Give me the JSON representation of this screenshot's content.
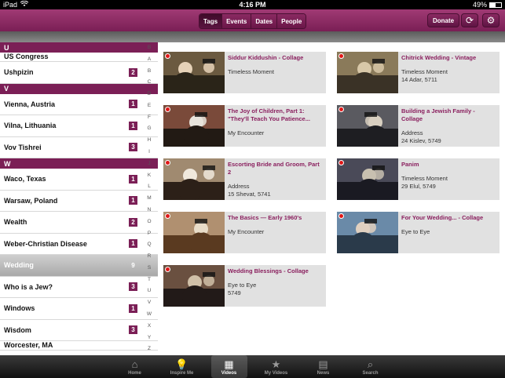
{
  "status_bar": {
    "device": "iPad",
    "time": "4:16 PM",
    "battery_percent_text": "49%",
    "battery_level": 0.49
  },
  "nav": {
    "segments": [
      {
        "label": "Tags",
        "active": true
      },
      {
        "label": "Events",
        "active": false
      },
      {
        "label": "Dates",
        "active": false
      },
      {
        "label": "People",
        "active": false
      }
    ],
    "donate_label": "Donate",
    "refresh_icon": "refresh-icon",
    "settings_icon": "gear-icon"
  },
  "tag_list": {
    "rows": [
      {
        "type": "header",
        "text": "U"
      },
      {
        "type": "partial",
        "text": "US Congress"
      },
      {
        "type": "row",
        "text": "Ushpizin",
        "count": "2"
      },
      {
        "type": "header",
        "text": "V"
      },
      {
        "type": "row",
        "text": "Vienna, Austria",
        "count": "1"
      },
      {
        "type": "row",
        "text": "Vilna, Lithuania",
        "count": "1"
      },
      {
        "type": "row",
        "text": "Vov Tishrei",
        "count": "3"
      },
      {
        "type": "header",
        "text": "W"
      },
      {
        "type": "row",
        "text": "Waco, Texas",
        "count": "1"
      },
      {
        "type": "row",
        "text": "Warsaw, Poland",
        "count": "1"
      },
      {
        "type": "row",
        "text": "Wealth",
        "count": "2"
      },
      {
        "type": "row",
        "text": "Weber-Christian Disease",
        "count": "1"
      },
      {
        "type": "row",
        "text": "Wedding",
        "count": "9",
        "selected": true
      },
      {
        "type": "row",
        "text": "Who is a Jew?",
        "count": "3"
      },
      {
        "type": "row",
        "text": "Windows",
        "count": "1"
      },
      {
        "type": "row",
        "text": "Wisdom",
        "count": "3"
      },
      {
        "type": "partial",
        "text": "Worcester, MA"
      }
    ],
    "index_letters": [
      "B",
      "A",
      "B",
      "C",
      "D",
      "E",
      "F",
      "G",
      "H",
      "I",
      "J",
      "K",
      "L",
      "M",
      "N",
      "O",
      "P",
      "Q",
      "R",
      "S",
      "T",
      "U",
      "V",
      "W",
      "X",
      "Y",
      "Z"
    ]
  },
  "videos": [
    {
      "title": "Siddur Kiddushin - Collage",
      "lines": [
        "Timeless Moment"
      ]
    },
    {
      "title": "Chitrick Wedding - Vintage",
      "lines": [
        "Timeless Moment",
        "14 Adar, 5711"
      ]
    },
    {
      "title": "The Joy of Children, Part 1: \"They'll Teach You Patience...",
      "lines": [
        "My Encounter"
      ]
    },
    {
      "title": "Building a Jewish Family - Collage",
      "lines": [
        "Address",
        "24 Kislev, 5749"
      ]
    },
    {
      "title": "Escorting Bride and Groom, Part 2",
      "lines": [
        "Address",
        "15 Shevat, 5741"
      ]
    },
    {
      "title": "Panim",
      "lines": [
        "Timeless Moment",
        "29 Elul, 5749"
      ]
    },
    {
      "title": "The Basics — Early 1960's",
      "lines": [
        "My Encounter"
      ]
    },
    {
      "title": "For Your Wedding... - Collage",
      "lines": [
        "Eye to Eye"
      ]
    },
    {
      "title": "Wedding Blessings - Collage",
      "lines": [
        "Eye to Eye",
        "5749"
      ]
    }
  ],
  "tabbar": [
    {
      "label": "Home",
      "icon": "home-icon",
      "glyph": "⌂",
      "active": false
    },
    {
      "label": "Inspire Me",
      "icon": "lightbulb-icon",
      "glyph": "💡",
      "active": false
    },
    {
      "label": "Videos",
      "icon": "film-icon",
      "glyph": "▦",
      "active": true
    },
    {
      "label": "My Videos",
      "icon": "star-icon",
      "glyph": "★",
      "active": false
    },
    {
      "label": "News",
      "icon": "newspaper-icon",
      "glyph": "▤",
      "active": false
    },
    {
      "label": "Search",
      "icon": "search-icon",
      "glyph": "⌕",
      "active": false
    }
  ]
}
